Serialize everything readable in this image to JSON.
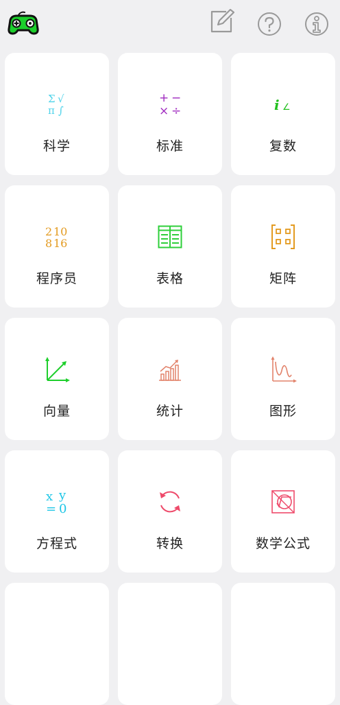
{
  "topbar": {
    "game_icon": "gamepad-icon",
    "edit_icon": "edit-icon",
    "help_icon": "help-icon",
    "info_icon": "info-icon",
    "colors": {
      "game_fill": "#1ccf2c",
      "game_outline": "#111111",
      "toolbar_icon": "#999999"
    }
  },
  "cards": [
    {
      "label": "科学",
      "icon": "scientific-icon",
      "color": "#4fd3ea"
    },
    {
      "label": "标准",
      "icon": "standard-operators-icon",
      "color": "#a02bc0"
    },
    {
      "label": "复数",
      "icon": "complex-number-icon",
      "color": "#22c01e"
    },
    {
      "label": "程序员",
      "icon": "programmer-icon",
      "color": "#e39a1f"
    },
    {
      "label": "表格",
      "icon": "table-icon",
      "color": "#2ecf3a"
    },
    {
      "label": "矩阵",
      "icon": "matrix-icon",
      "color": "#e39a1f"
    },
    {
      "label": "向量",
      "icon": "vector-icon",
      "color": "#1ecf2c"
    },
    {
      "label": "统计",
      "icon": "statistics-icon",
      "color": "#e2826a"
    },
    {
      "label": "图形",
      "icon": "graph-icon",
      "color": "#e2826a"
    },
    {
      "label": "方程式",
      "icon": "equation-icon",
      "color": "#1ec6e6"
    },
    {
      "label": "转换",
      "icon": "conversion-icon",
      "color": "#ee4a6a"
    },
    {
      "label": "数学公式",
      "icon": "math-formula-icon",
      "color": "#ee4a6a"
    }
  ],
  "icon_text": {
    "scientific": [
      "Σ",
      "√",
      "π",
      "∫"
    ],
    "standard": [
      "+",
      "−",
      "×",
      "÷"
    ],
    "complex": [
      "i",
      "∠"
    ],
    "programmer": [
      "2",
      "10",
      "8",
      "16"
    ],
    "equation": [
      "x",
      "y",
      "=",
      "0"
    ]
  }
}
